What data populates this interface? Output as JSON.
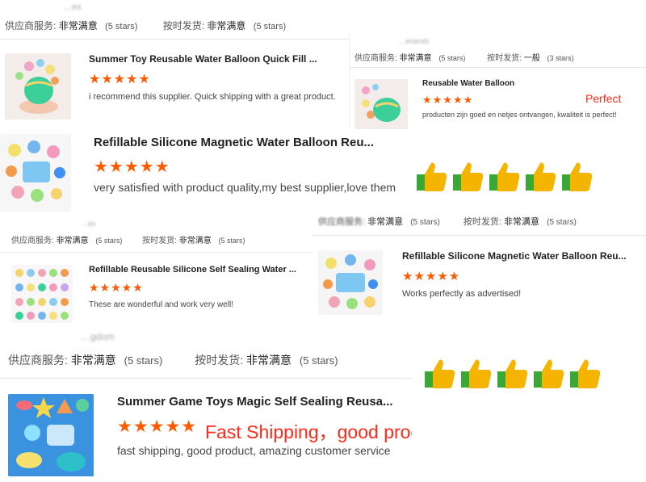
{
  "reviews": [
    {
      "country": "…es",
      "service_label": "供应商服务:",
      "service_value": "非常满意",
      "service_stars": "(5 stars)",
      "shipping_label": "按时发货:",
      "shipping_value": "非常满意",
      "shipping_stars": "(5 stars)",
      "title": "Summer Toy Reusable Water Balloon Quick Fill ...",
      "rating": "★★★★★",
      "text": "i recommend this supplier.  Quick shipping with a great product."
    },
    {
      "country": "…erlands",
      "service_label": "供应商服务:",
      "service_value": "非常满意",
      "service_stars": "(5 stars)",
      "shipping_label": "按时发货:",
      "shipping_value": "一般",
      "shipping_stars": "(3 stars)",
      "title": "Reusable Water Balloon",
      "rating": "★★★★★",
      "highlight": "Perfect",
      "text": "producten zijn goed en netjes ontvangen, kwaliteit is perfect!"
    },
    {
      "title": "Refillable Silicone Magnetic Water Balloon Reu...",
      "rating": "★★★★★",
      "text": "very satisfied with product quality,my best supplier,love them"
    },
    {
      "country": "…es",
      "service_label": "供应商服务:",
      "service_value": "非常满意",
      "service_stars": "(5 stars)",
      "shipping_label": "按时发货:",
      "shipping_value": "非常满意",
      "shipping_stars": "(5 stars)",
      "title": "Refillable Reusable Silicone Self Sealing Water ...",
      "rating": "★★★★★",
      "text": "These are wonderful and work very well!"
    },
    {
      "service_label": "供应商服务:",
      "service_value": "非常满意",
      "service_stars": "(5 stars)",
      "shipping_label": "按时发货:",
      "shipping_value": "非常满意",
      "shipping_stars": "(5 stars)",
      "title": "Refillable Silicone Magnetic Water Balloon Reu...",
      "rating": "★★★★★",
      "text": "Works perfectly as advertised!"
    },
    {
      "country": "…gdom",
      "service_label": "供应商服务:",
      "service_value": "非常满意",
      "service_stars": "(5 stars)",
      "shipping_label": "按时发货:",
      "shipping_value": "非常满意",
      "shipping_stars": "(5 stars)",
      "title": "Summer Game Toys Magic Self Sealing Reusa...",
      "rating": "★★★★★",
      "highlight": "Fast Shipping，good product",
      "text": "fast shipping, good product, amazing customer service"
    }
  ],
  "thumbs_up_icon": "thumbs-up-icon",
  "colors": {
    "star": "#ff5a00",
    "highlight": "#ff2a1a",
    "thumb": "#f5b400",
    "cuff": "#3aa835"
  }
}
